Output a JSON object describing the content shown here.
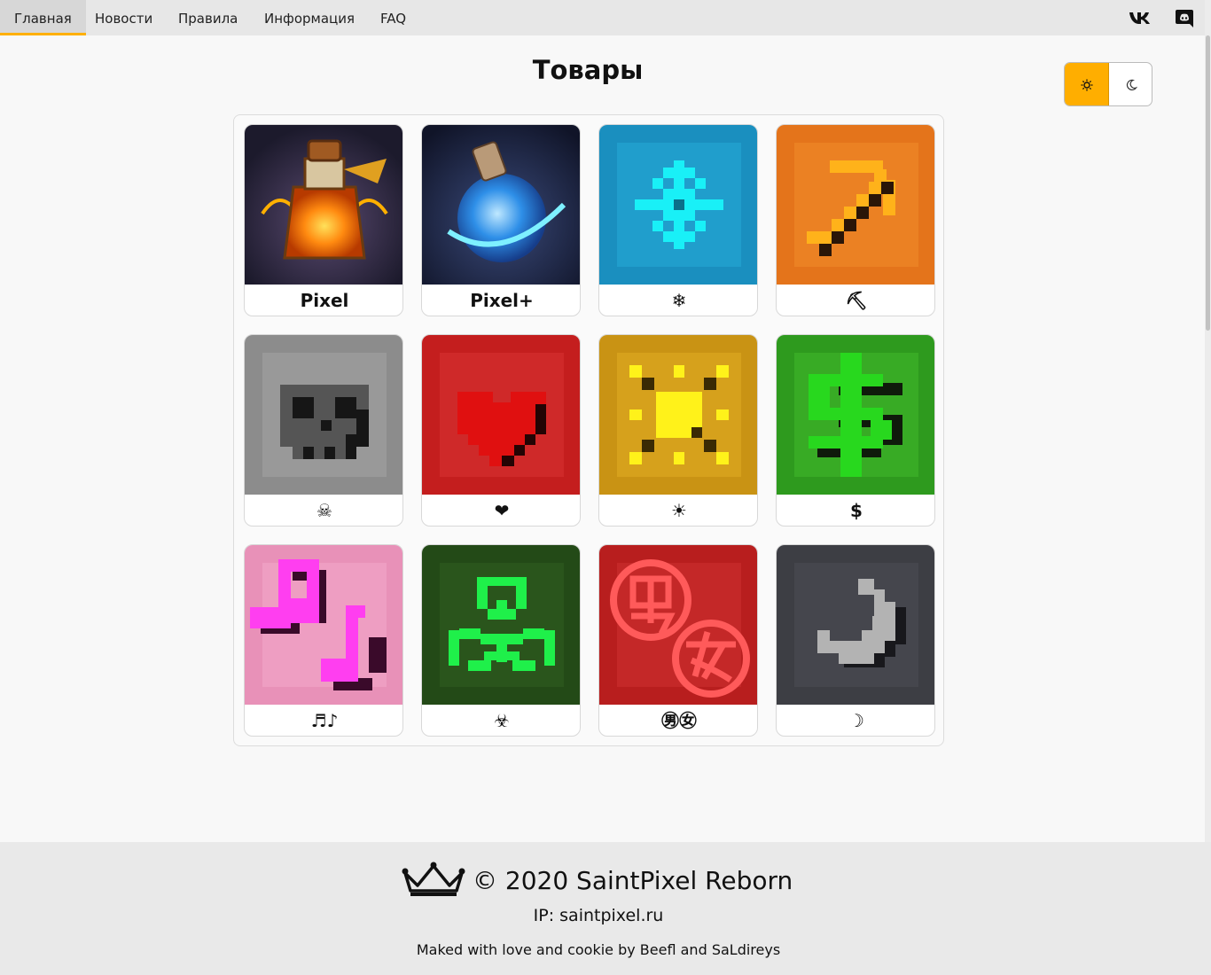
{
  "nav": {
    "items": [
      {
        "label": "Главная",
        "active": true
      },
      {
        "label": "Новости",
        "active": false
      },
      {
        "label": "Правила",
        "active": false
      },
      {
        "label": "Информация",
        "active": false
      },
      {
        "label": "FAQ",
        "active": false
      }
    ],
    "social_icons": [
      "vk-icon",
      "discord-icon"
    ]
  },
  "page": {
    "title": "Товары"
  },
  "theme_toggle": {
    "options": [
      "sun-icon",
      "moon-icon"
    ],
    "selected": "light"
  },
  "colors": {
    "accent": "#ffae00",
    "nav_bg": "#e7e7e7",
    "footer_bg": "#e9e9e9",
    "page_bg": "#f8f8f8"
  },
  "products": [
    {
      "label": "Pixel",
      "art": "orange-potion-icon"
    },
    {
      "label": "Pixel+",
      "art": "blue-potion-icon"
    },
    {
      "label": "❄",
      "art": "snowflake-icon"
    },
    {
      "label": "⛏",
      "art": "pickaxe-icon"
    },
    {
      "label": "☠",
      "art": "skull-icon"
    },
    {
      "label": "❤",
      "art": "heart-icon"
    },
    {
      "label": "☀",
      "art": "sun-icon"
    },
    {
      "label": "$",
      "art": "dollar-icon"
    },
    {
      "label": "♬♪",
      "art": "music-notes-icon"
    },
    {
      "label": "☣",
      "art": "biohazard-icon"
    },
    {
      "label": "㊚㊛",
      "art": "male-female-kanji-icon"
    },
    {
      "label": "☽",
      "art": "crescent-moon-icon"
    }
  ],
  "footer": {
    "copyright": "© 2020 SaintPixel Reborn",
    "ip": "IP: saintpixel.ru",
    "credits": "Maked with love and cookie by Beefl and SaLdireys"
  }
}
